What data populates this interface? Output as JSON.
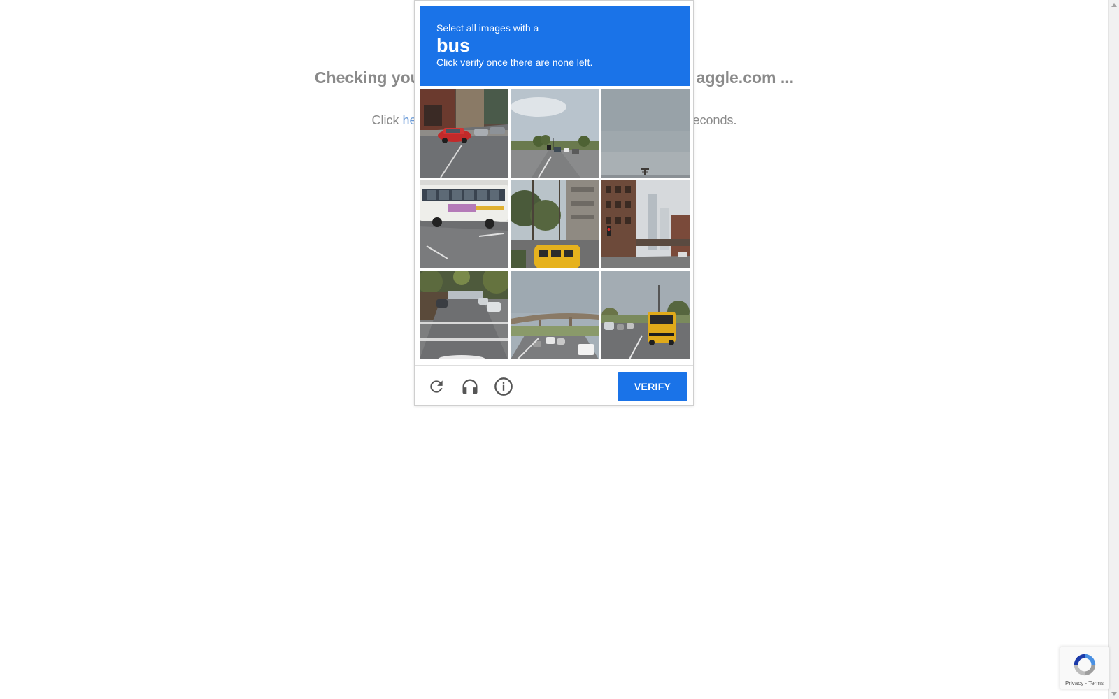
{
  "background_page": {
    "heading_left": "Checking you",
    "heading_right": "aggle.com ...",
    "line_prefix": "Click ",
    "line_link": "he",
    "line_suffix": "econds."
  },
  "challenge": {
    "instruction_line1": "Select all images with a",
    "keyword": "bus",
    "instruction_line2": "Click verify once there are none left.",
    "header_color": "#1a73e8",
    "tiles": [
      {
        "row": 1,
        "col": 1,
        "depicts": "street with red car and storefronts"
      },
      {
        "row": 1,
        "col": 2,
        "depicts": "wide road with traffic and trees"
      },
      {
        "row": 1,
        "col": 3,
        "depicts": "sky with utility pole top"
      },
      {
        "row": 2,
        "col": 1,
        "depicts": "white city bus on street"
      },
      {
        "row": 2,
        "col": 2,
        "depicts": "trees and yellow school bus roof"
      },
      {
        "row": 2,
        "col": 3,
        "depicts": "city street with tall buildings and traffic light"
      },
      {
        "row": 3,
        "col": 1,
        "depicts": "residential street with parked cars"
      },
      {
        "row": 3,
        "col": 2,
        "depicts": "highway overpass with cars"
      },
      {
        "row": 3,
        "col": 3,
        "depicts": "road with yellow school bus"
      }
    ],
    "controls": {
      "reload_icon": "reload-icon",
      "audio_icon": "headphones-icon",
      "info_icon": "info-icon"
    },
    "verify_label": "VERIFY"
  },
  "badge": {
    "privacy_label": "Privacy",
    "separator": " - ",
    "terms_label": "Terms"
  }
}
